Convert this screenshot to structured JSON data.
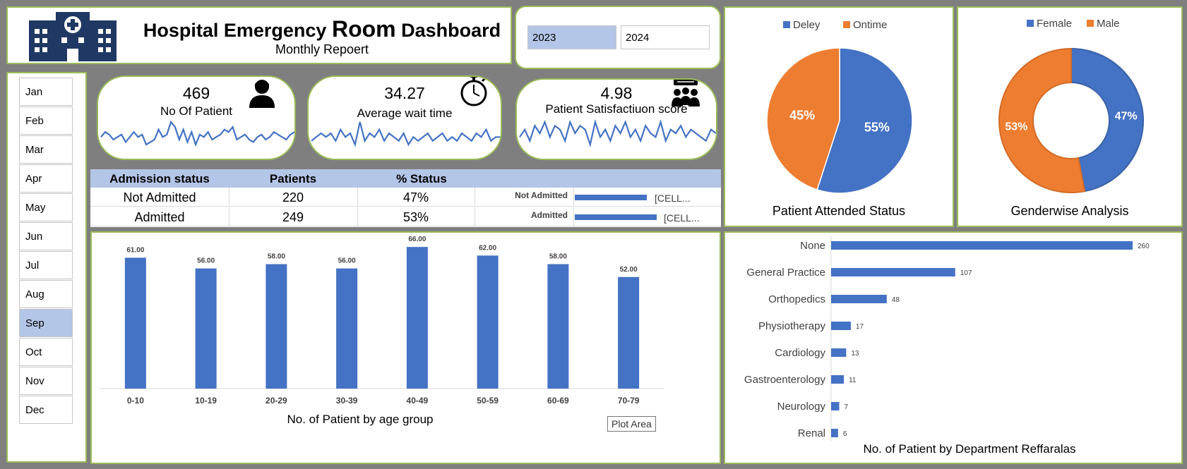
{
  "header": {
    "title_part1": "Hospital Emergency ",
    "title_part2": "Room",
    "title_part3": " Dashboard",
    "subtitle": "Monthly Repoert"
  },
  "years": [
    {
      "label": "2023",
      "selected": true
    },
    {
      "label": "2024",
      "selected": false
    }
  ],
  "months": [
    {
      "label": "Jan"
    },
    {
      "label": "Feb"
    },
    {
      "label": "Mar"
    },
    {
      "label": "Apr"
    },
    {
      "label": "May"
    },
    {
      "label": "Jun"
    },
    {
      "label": "Jul"
    },
    {
      "label": "Aug"
    },
    {
      "label": "Sep",
      "selected": true
    },
    {
      "label": "Oct"
    },
    {
      "label": "Nov"
    },
    {
      "label": "Dec"
    }
  ],
  "kpis": {
    "patients": {
      "value": "469",
      "label": "No Of Patient",
      "icon": "person-icon"
    },
    "wait": {
      "value": "34.27",
      "label": "Average wait time",
      "icon": "stopwatch-icon"
    },
    "satisfaction": {
      "value": "4.98",
      "label": "Patient Satisfactiuon score",
      "icon": "audience-icon"
    }
  },
  "admission": {
    "headers": [
      "Admission status",
      "Patients",
      "% Status"
    ],
    "rows": [
      {
        "status": "Not Admitted",
        "patients": "220",
        "pct": "47%",
        "bar_label": "Not Admitted",
        "cell": "[CELL...",
        "bar_value": 220
      },
      {
        "status": "Admitted",
        "patients": "249",
        "pct": "53%",
        "bar_label": "Admitted",
        "cell": "[CELL...",
        "bar_value": 249
      }
    ]
  },
  "colors": {
    "blue": "#4472c4",
    "orange": "#ed7d31",
    "border": "#9bbb59",
    "slicer_selected": "#b4c6e7"
  },
  "tooltip": "Plot Area",
  "chart_data": [
    {
      "type": "bar",
      "title": "No. of Patient by age group",
      "categories": [
        "0-10",
        "10-19",
        "20-29",
        "30-39",
        "40-49",
        "50-59",
        "60-69",
        "70-79"
      ],
      "values": [
        61,
        56,
        58,
        56,
        66,
        62,
        58,
        52
      ],
      "value_labels": [
        "61.00",
        "56.00",
        "58.00",
        "56.00",
        "66.00",
        "62.00",
        "58.00",
        "52.00"
      ],
      "ylim": [
        0,
        70
      ],
      "grid": false
    },
    {
      "type": "bar",
      "orientation": "horizontal",
      "title": "No. of Patient by Department Reffaralas",
      "categories": [
        "None",
        "General Practice",
        "Orthopedics",
        "Physiotherapy",
        "Cardiology",
        "Gastroenterology",
        "Neurology",
        "Renal"
      ],
      "values": [
        260,
        107,
        48,
        17,
        13,
        11,
        7,
        6
      ],
      "grid": false
    },
    {
      "type": "pie",
      "title": "Patient Attended Status",
      "labels": [
        "Deley",
        "Ontime"
      ],
      "values": [
        55,
        45
      ],
      "value_labels": [
        "55%",
        "45%"
      ],
      "colors": [
        "#4472c4",
        "#ed7d31"
      ],
      "legend": "top"
    },
    {
      "type": "pie",
      "variant": "doughnut",
      "title": "Genderwise Analysis",
      "labels": [
        "Female",
        "Male"
      ],
      "values": [
        47,
        53
      ],
      "value_labels": [
        "47%",
        "53%"
      ],
      "colors": [
        "#4472c4",
        "#ed7d31"
      ],
      "legend": "top"
    }
  ],
  "sparklines": {
    "patients": [
      4,
      6,
      5,
      3,
      4,
      5,
      2,
      4,
      6,
      4,
      5,
      1,
      2,
      3,
      7,
      4,
      5,
      10,
      8,
      3,
      7,
      2,
      6,
      1,
      5,
      4,
      6,
      3,
      4,
      5,
      7,
      6,
      8,
      3,
      4,
      5,
      3,
      2,
      4,
      5,
      3,
      4,
      6,
      5,
      4,
      3,
      5,
      6
    ],
    "wait": [
      3,
      4,
      5,
      4,
      5,
      3,
      6,
      4,
      5,
      2,
      8,
      3,
      5,
      4,
      6,
      3,
      5,
      4,
      3,
      5,
      2,
      4,
      3,
      4,
      5,
      3,
      4,
      5,
      3,
      4,
      3,
      5,
      4,
      3,
      5,
      4,
      6,
      3,
      4,
      4
    ],
    "satisfaction": [
      4,
      6,
      3,
      7,
      5,
      8,
      4,
      7,
      6,
      3,
      8,
      5,
      7,
      6,
      2,
      8,
      4,
      6,
      3,
      7,
      5,
      8,
      4,
      6,
      3,
      7,
      5,
      4,
      8,
      3,
      6,
      5,
      7,
      4,
      6,
      5,
      4,
      3,
      6,
      5
    ]
  }
}
